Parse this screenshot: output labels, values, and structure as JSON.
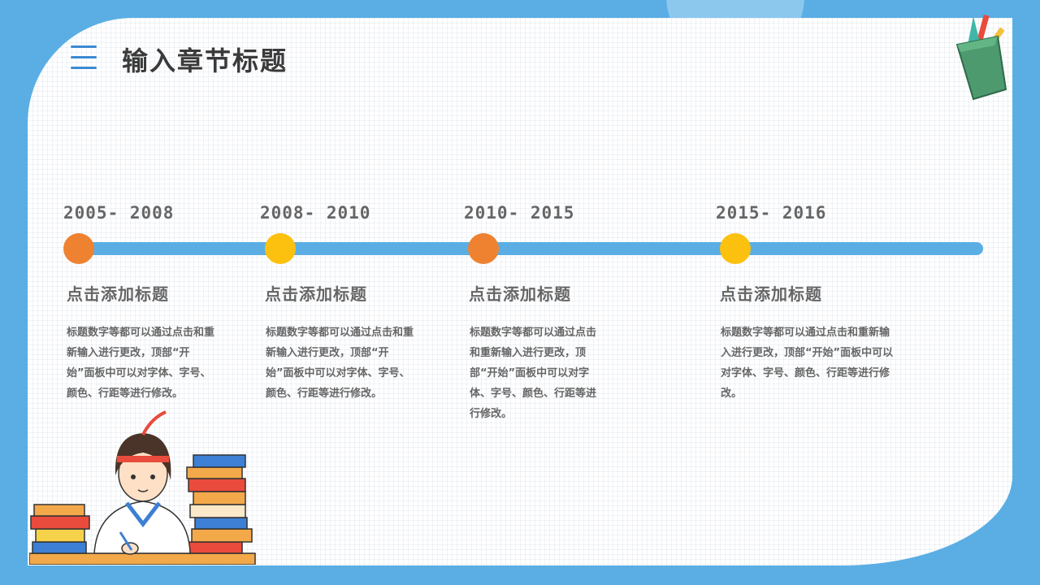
{
  "header": {
    "title": "输入章节标题"
  },
  "timeline": [
    {
      "year": "2005- 2008",
      "color": "#ee8231",
      "title": "点击添加标题",
      "body": "标题数字等都可以通过点击和重新输入进行更改，顶部“开始”面板中可以对字体、字号、颜色、行距等进行修改。"
    },
    {
      "year": "2008- 2010",
      "color": "#fcc10f",
      "title": "点击添加标题",
      "body": "标题数字等都可以通过点击和重新输入进行更改，顶部“开始”面板中可以对字体、字号、颜色、行距等进行修改。"
    },
    {
      "year": "2010- 2015",
      "color": "#ee8231",
      "title": "点击添加标题",
      "body": "标题数字等都可以通过点击和重新输入进行更改，顶部“开始”面板中可以对字体、字号、颜色、行距等进行修改。"
    },
    {
      "year": "2015- 2016",
      "color": "#fcc10f",
      "title": "点击添加标题",
      "body": "标题数字等都可以通过点击和重新输入进行更改，顶部“开始”面板中可以对字体、字号、颜色、行距等进行修改。"
    }
  ],
  "icons": {
    "menu": "menu-icon",
    "pencil_cup": "pencil-cup-icon",
    "student": "student-illustration"
  },
  "colors": {
    "frame": "#5aaee4",
    "bar": "#5aaee4",
    "orange": "#ee8231",
    "yellow": "#fcc10f"
  }
}
